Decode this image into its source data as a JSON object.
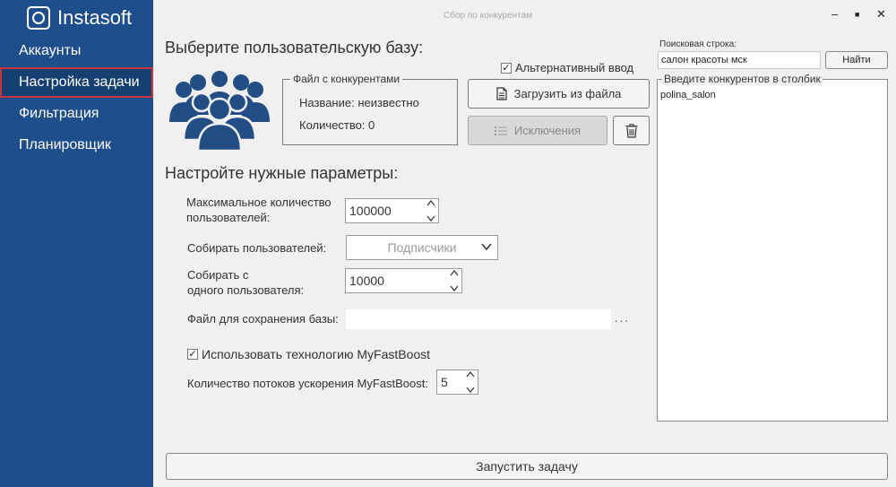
{
  "app": {
    "logo_text": "Instasoft",
    "window_title": "Сбор по конкурентам"
  },
  "window_controls": {
    "minimize": "–",
    "maximize": "■",
    "close": "✕"
  },
  "sidebar": {
    "items": [
      {
        "label": "Аккаунты",
        "active": false
      },
      {
        "label": "Настройка задачи",
        "active": true
      },
      {
        "label": "Фильтрация",
        "active": false
      },
      {
        "label": "Планировщик",
        "active": false
      }
    ]
  },
  "base_section": {
    "heading": "Выберите пользовательскую базу:",
    "alt_input_label": "Альтернативный ввод",
    "alt_input_checked": true,
    "file_group": {
      "legend": "Файл с конкурентами",
      "name_text": "Название: неизвестно",
      "count_text": "Количество: 0"
    },
    "load_button": "Загрузить из файла",
    "exclusions_button": "Исключения"
  },
  "params": {
    "heading": "Настройте нужные параметры:",
    "max_users_label_1": "Максимальное количество",
    "max_users_label_2": "пользователей:",
    "max_users_value": "100000",
    "collect_users_label": "Собирать пользователей:",
    "collect_users_value": "Подписчики",
    "per_user_label_1": "Собирать с",
    "per_user_label_2": "одного пользователя:",
    "per_user_value": "10000",
    "save_file_label": "Файл для сохранения базы:",
    "save_file_value": "",
    "browse_label": "...",
    "boost_label": "Использовать технологию MyFastBoost",
    "boost_checked": true,
    "threads_label": "Количество потоков ускорения MyFastBoost:",
    "threads_value": "5"
  },
  "search": {
    "label": "Поисковая строка:",
    "value": "салон красоты мск",
    "find_button": "Найти"
  },
  "competitors": {
    "legend": "Введите конкурентов в столбик",
    "text": "polina_salon"
  },
  "start_button": "Запустить задачу",
  "colors": {
    "sidebar_bg": "#1e4e8c",
    "active_border": "#c8353e",
    "icon_blue": "#234d85",
    "window_bg": "#f0f0f0"
  },
  "icons": {
    "logo": "instasoft-logo-icon",
    "users": "users-group-icon",
    "document": "document-icon",
    "list": "list-icon",
    "trash": "trash-icon",
    "checkmark": "checkmark-icon",
    "spinner": "spinner-arrows-icon",
    "dropdown": "chevron-down-icon"
  }
}
